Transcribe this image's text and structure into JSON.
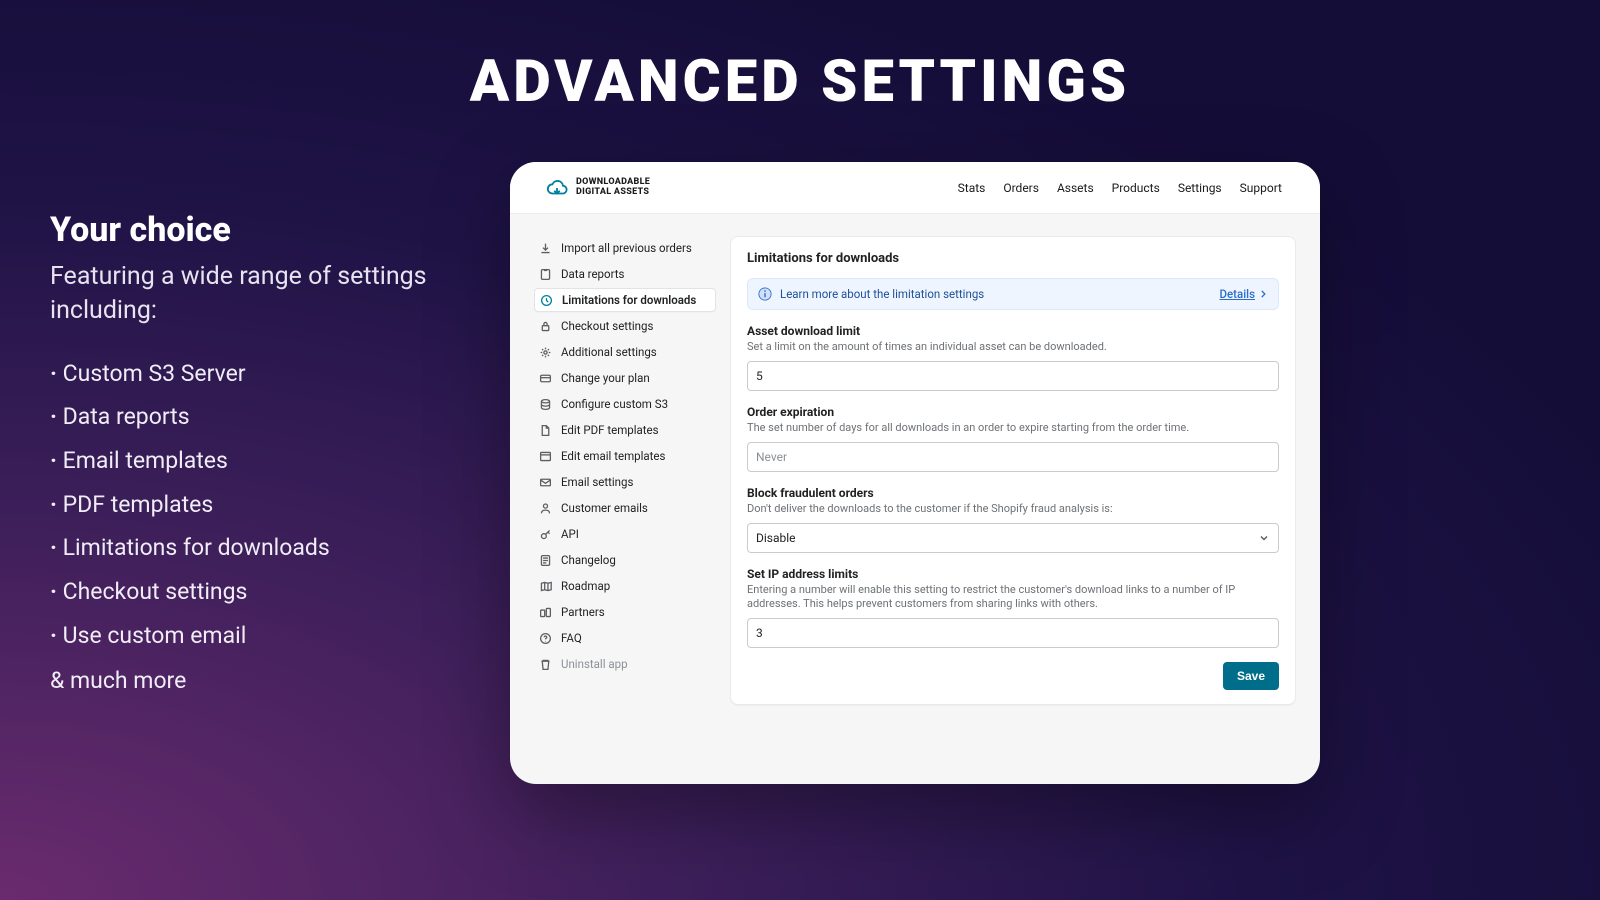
{
  "hero": {
    "title": "ADVANCED SETTINGS"
  },
  "left": {
    "sub1": "Your choice",
    "sub2": "Featuring a wide range of settings including:",
    "items": [
      "Custom S3 Server",
      "Data reports",
      "Email templates",
      "PDF templates",
      "Limitations for downloads",
      "Checkout settings",
      "Use custom email"
    ],
    "more": "& much more"
  },
  "brand": {
    "line1": "DOWNLOADABLE",
    "line2": "DIGITAL ASSETS"
  },
  "topnav": [
    "Stats",
    "Orders",
    "Assets",
    "Products",
    "Settings",
    "Support"
  ],
  "sidebar": {
    "items": [
      {
        "label": "Import all previous orders"
      },
      {
        "label": "Data reports"
      },
      {
        "label": "Limitations for downloads"
      },
      {
        "label": "Checkout settings"
      },
      {
        "label": "Additional settings"
      },
      {
        "label": "Change your plan"
      },
      {
        "label": "Configure custom S3"
      },
      {
        "label": "Edit PDF templates"
      },
      {
        "label": "Edit email templates"
      },
      {
        "label": "Email settings"
      },
      {
        "label": "Customer emails"
      },
      {
        "label": "API"
      },
      {
        "label": "Changelog"
      },
      {
        "label": "Roadmap"
      },
      {
        "label": "Partners"
      },
      {
        "label": "FAQ"
      },
      {
        "label": "Uninstall app"
      }
    ],
    "activeIndex": 2
  },
  "panel": {
    "title": "Limitations for downloads",
    "banner": {
      "text": "Learn more about the limitation settings",
      "details": "Details"
    },
    "fields": {
      "assetLimit": {
        "label": "Asset download limit",
        "help": "Set a limit on the amount of times an individual asset can be downloaded.",
        "value": "5"
      },
      "orderExpiration": {
        "label": "Order expiration",
        "help": "The set number of days for all downloads in an order to expire starting from the order time.",
        "placeholder": "Never"
      },
      "blockFraud": {
        "label": "Block fraudulent orders",
        "help": "Don't deliver the downloads to the customer if the Shopify fraud analysis is:",
        "value": "Disable"
      },
      "ipLimits": {
        "label": "Set IP address limits",
        "help": "Entering a number will enable this setting to restrict the customer's download links to a number of IP addresses. This helps prevent customers from sharing links with others.",
        "value": "3"
      }
    },
    "saveLabel": "Save"
  }
}
